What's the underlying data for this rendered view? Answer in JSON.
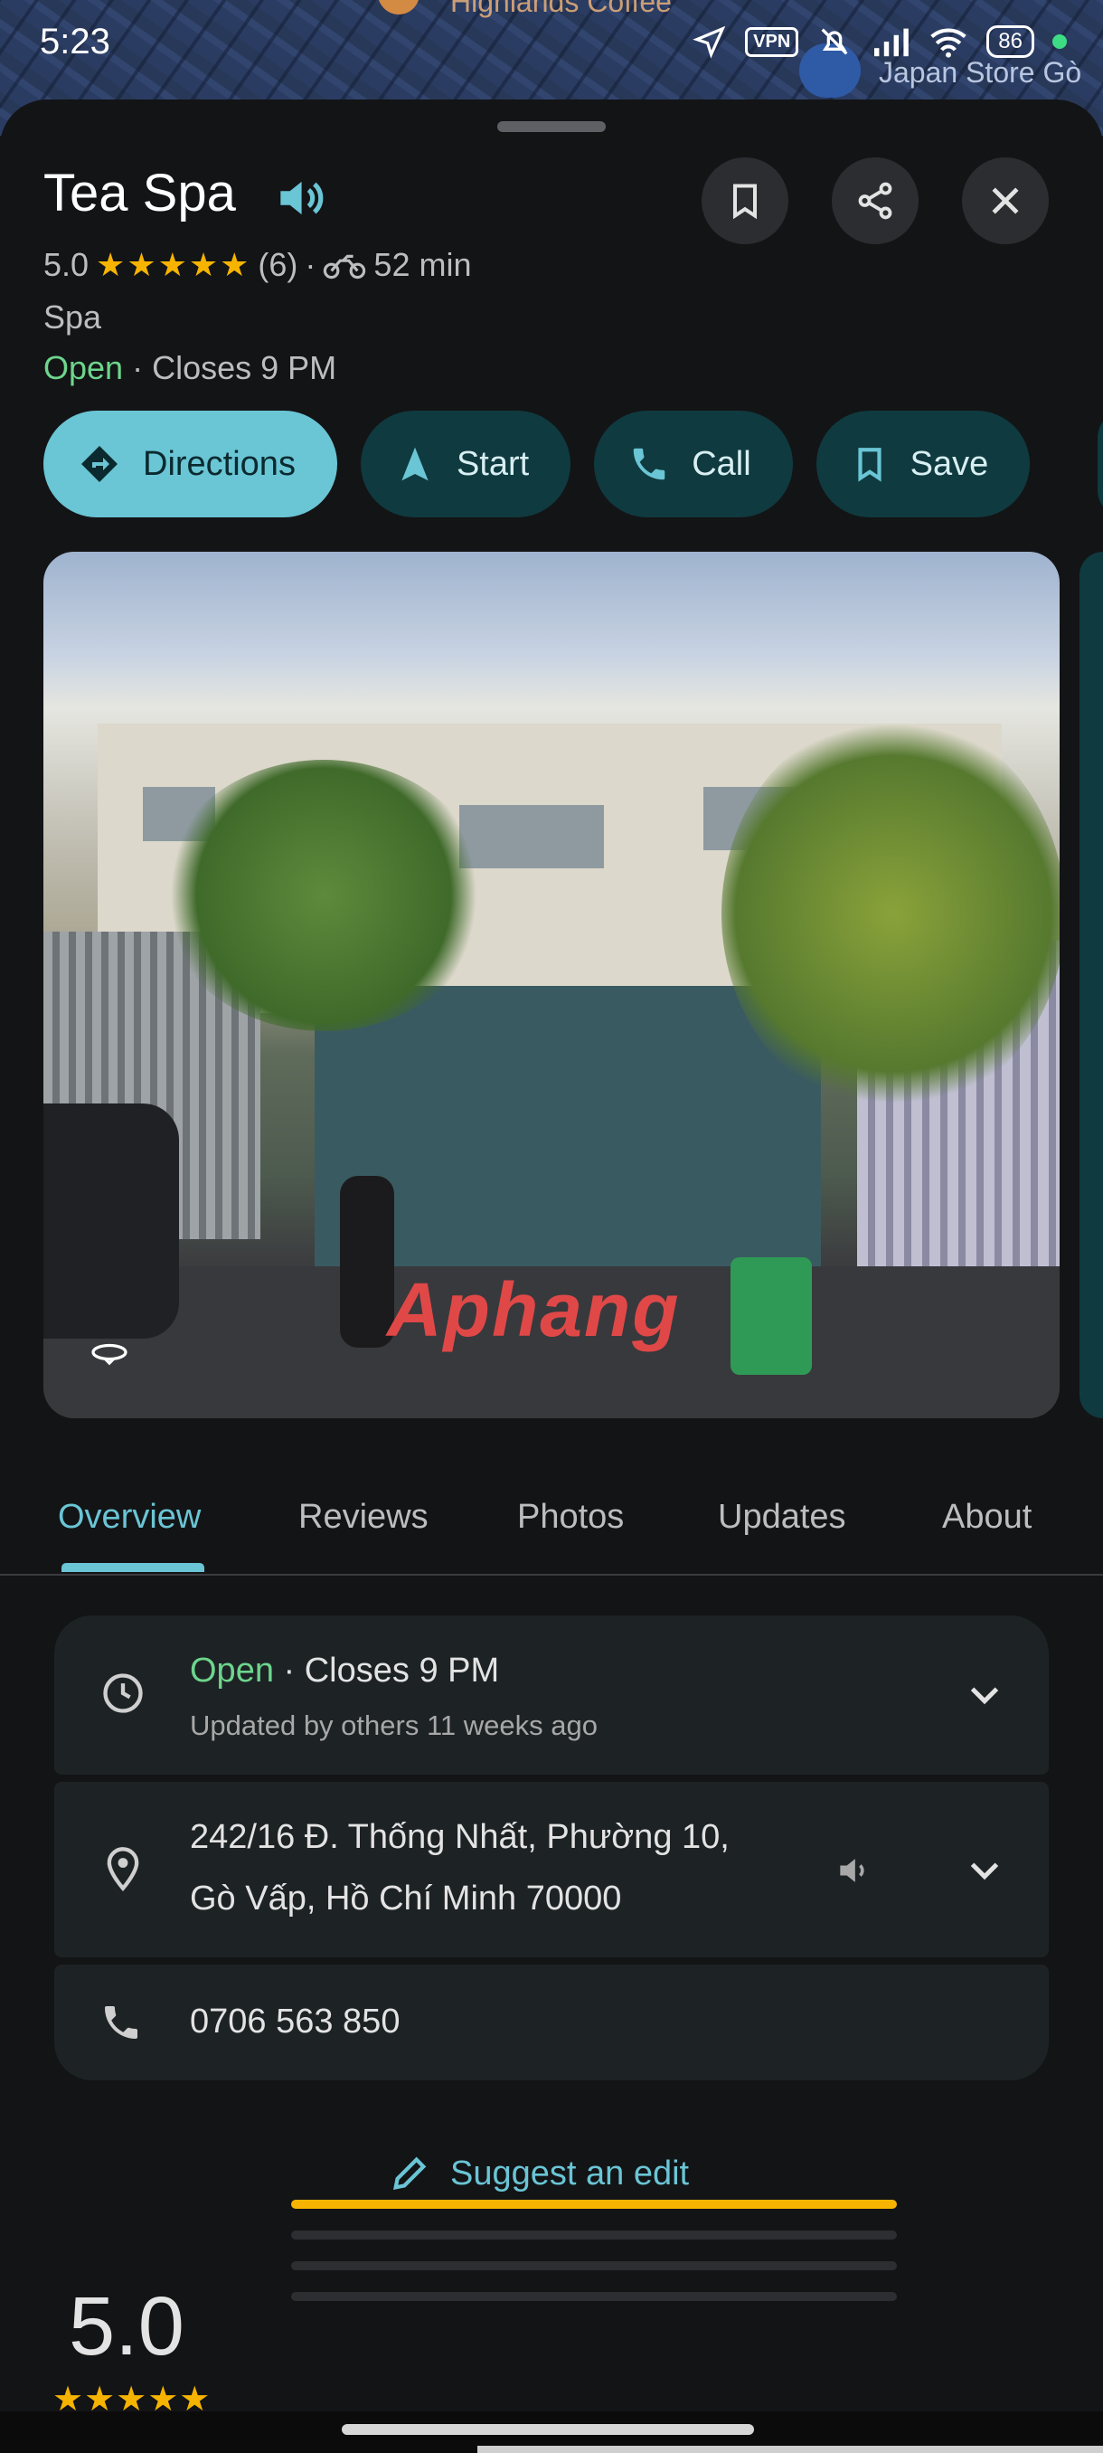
{
  "status_bar": {
    "time": "5:23",
    "vpn": "VPN",
    "battery": "86"
  },
  "map": {
    "poi_label": "Highlands Coffee",
    "store_label": "Japan Store Gò"
  },
  "place": {
    "title": "Tea Spa",
    "rating": "5.0",
    "stars": "★★★★★",
    "review_count": "(6)",
    "separator": "·",
    "travel_time": "52 min",
    "category": "Spa",
    "open_status": "Open",
    "closes": "· Closes 9 PM"
  },
  "actions": [
    {
      "label": "Directions",
      "icon": "directions-icon"
    },
    {
      "label": "Start",
      "icon": "navigation-arrow-icon"
    },
    {
      "label": "Call",
      "icon": "phone-icon"
    },
    {
      "label": "Save",
      "icon": "bookmark-icon"
    }
  ],
  "photo": {
    "watermark": "Aphang"
  },
  "tabs": [
    "Overview",
    "Reviews",
    "Photos",
    "Updates",
    "About"
  ],
  "active_tab": "Overview",
  "details": {
    "hours_status": "Open",
    "hours_closes": "· Closes 9 PM",
    "hours_sub": "Updated by others 11 weeks ago",
    "address_line1": "242/16 Đ. Thống Nhất, Phường 10,",
    "address_line2": "Gò Vấp, Hồ Chí Minh 70000",
    "phone": "0706 563 850"
  },
  "suggest_edit": "Suggest an edit",
  "summary": {
    "rating": "5.0",
    "stars": "★★★★★",
    "distribution": [
      1.0,
      0.0,
      0.0,
      0.0
    ]
  },
  "colors": {
    "accent": "#6ac5d5",
    "open": "#6dd58c",
    "star": "#f6b400",
    "background": "#131416"
  }
}
